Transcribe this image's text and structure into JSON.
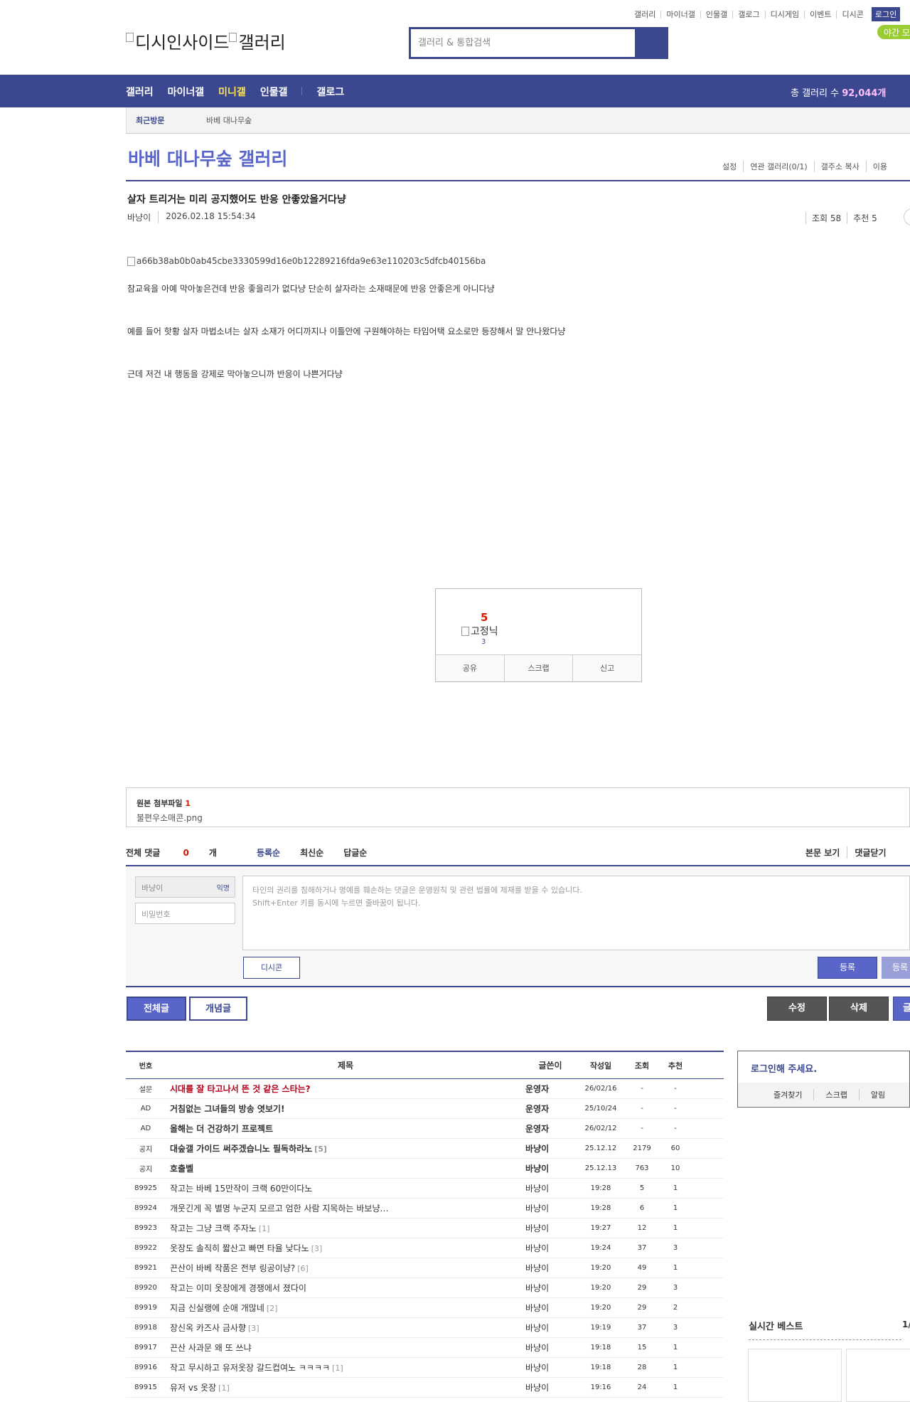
{
  "top_links": [
    "갤러리",
    "마이너갤",
    "인물갤",
    "갤로그",
    "디시게임",
    "이벤트",
    "디시콘"
  ],
  "login_label": "로그인",
  "night_mode_label": "야간 모",
  "logo": {
    "alt1": "디시인사이드",
    "alt2": "갤러리"
  },
  "search": {
    "placeholder": "갤러리 & 통합검색"
  },
  "nav": {
    "items": [
      "갤러리",
      "마이너갤",
      "미니갤",
      "인물갤",
      "갤로그"
    ],
    "active": "미니갤",
    "gallery_count_label": "총 갤러리 수 ",
    "gallery_count_value": "92,044개"
  },
  "recent": {
    "title": "최근방문",
    "gallery": "바베 대나무숲"
  },
  "gallery": {
    "title": "바베 대나무숲 갤러리",
    "links": [
      "설정",
      "연관 갤러리(0/1)",
      "갤주소 복사",
      "이용"
    ]
  },
  "post": {
    "title": "살자 트리거는 미리 공지했어도 반응 안좋았을거다냥",
    "author": "바냥이",
    "date": "2026.02.18 15:54:34",
    "views": "조회 58",
    "recommends": "추천 5",
    "image_alt": "a66b38ab0b0ab45cbe3330599d16e0b12289216fda9e63e110203c5dfcb40156ba",
    "paragraphs": [
      "참교육을 아예 막아놓은건데 반응 좋을리가 없다냥 단순히 살자라는 소재때문에 반응 안좋은게 아니다냥",
      "예를 들어 핫황 살자 마법소녀는 살자 소재가 어디까지나 이틀안에 구원해야하는 타임어택 요소로만 등장해서 말 안나왔다냥",
      "근데 저건 내 행동을 강제로 막아놓으니까 반응이 나쁜거다냥"
    ]
  },
  "recommend_box": {
    "count": "5",
    "fixed_alt": "고정닉",
    "fixed_count": "3",
    "buttons": [
      "공유",
      "스크랩",
      "신고"
    ]
  },
  "attachment": {
    "label": "원본 첨부파일 ",
    "count": "1",
    "file": "불편우소매콘.png"
  },
  "comments": {
    "total_label": "전체 댓글 ",
    "total_count": "0",
    "total_unit": "개",
    "sorts": [
      "등록순",
      "최신순",
      "답글순"
    ],
    "right_links": [
      "본문 보기",
      "댓글닫기"
    ],
    "nick_placeholder": "바냥이",
    "anon_label": "익명",
    "password_placeholder": "비밀번호",
    "textarea_line1": "타인의 권리를 침해하거나 명예를 훼손하는 댓글은 운영원칙 및 관련 법률에 제재를 받을 수 있습니다.",
    "textarea_line2": "Shift+Enter 키를 동시에 누르면 줄바꿈이 됩니다.",
    "dccon_label": "디시콘",
    "submit_label": "등록",
    "submit2_label": "등록"
  },
  "buttons": {
    "all": "전체글",
    "good": "개념글",
    "edit": "수정",
    "delete": "삭제",
    "write": "글"
  },
  "list": {
    "headers": [
      "번호",
      "제목",
      "글쓴이",
      "작성일",
      "조회",
      "추천"
    ],
    "rows": [
      {
        "num": "설문",
        "title": "시대를 잘 타고나서 뜬 것 같은 스타는?",
        "rc": "",
        "writer": "운영자",
        "date": "26/02/16",
        "views": "-",
        "reco": "-",
        "type": "survey"
      },
      {
        "num": "AD",
        "title": "거침없는 그녀들의 방송 엿보기!",
        "rc": "",
        "writer": "운영자",
        "date": "25/10/24",
        "views": "-",
        "reco": "-",
        "type": "bold"
      },
      {
        "num": "AD",
        "title": "올해는 더 건강하기 프로젝트",
        "rc": "",
        "writer": "운영자",
        "date": "26/02/12",
        "views": "-",
        "reco": "-",
        "type": "bold"
      },
      {
        "num": "공지",
        "title": "대숲갤 가이드 써주겠습니노 필독하라노",
        "rc": "[5]",
        "writer": "바냥이",
        "date": "25.12.12",
        "views": "2179",
        "reco": "60",
        "type": "bold"
      },
      {
        "num": "공지",
        "title": "호출벨",
        "rc": "",
        "writer": "바냥이",
        "date": "25.12.13",
        "views": "763",
        "reco": "10",
        "type": "bold"
      },
      {
        "num": "89925",
        "title": "작고는 바베 15만작이 크랙 60만이다노",
        "rc": "",
        "writer": "바냥이",
        "date": "19:28",
        "views": "5",
        "reco": "1",
        "type": ""
      },
      {
        "num": "89924",
        "title": "개웃긴게 꼭 별명 누군지 모르고 엄한 사람 지목하는 바보냥…",
        "rc": "",
        "writer": "바냥이",
        "date": "19:28",
        "views": "6",
        "reco": "1",
        "type": ""
      },
      {
        "num": "89923",
        "title": "작고는 그냥 크랙 주자노",
        "rc": "[1]",
        "writer": "바냥이",
        "date": "19:27",
        "views": "12",
        "reco": "1",
        "type": ""
      },
      {
        "num": "89922",
        "title": "옷장도 솔직히 짧산고 빠면 타율 낮다노",
        "rc": "[3]",
        "writer": "바냥이",
        "date": "19:24",
        "views": "37",
        "reco": "3",
        "type": ""
      },
      {
        "num": "89921",
        "title": "끈산이 바베 작품은 전부 링공이냥?",
        "rc": "[6]",
        "writer": "바냥이",
        "date": "19:20",
        "views": "49",
        "reco": "1",
        "type": ""
      },
      {
        "num": "89920",
        "title": "작고는 이미 옷장에게 경쟁에서 졌다이",
        "rc": "",
        "writer": "바냥이",
        "date": "19:20",
        "views": "29",
        "reco": "3",
        "type": ""
      },
      {
        "num": "89919",
        "title": "지금 신실랭에 순애 개많네",
        "rc": "[2]",
        "writer": "바냥이",
        "date": "19:20",
        "views": "29",
        "reco": "2",
        "type": ""
      },
      {
        "num": "89918",
        "title": "장신옥 카즈사 금사향",
        "rc": "[3]",
        "writer": "바냥이",
        "date": "19:19",
        "views": "37",
        "reco": "3",
        "type": ""
      },
      {
        "num": "89917",
        "title": "끈산 사과문 왜 또 쓰냐",
        "rc": "",
        "writer": "바냥이",
        "date": "19:18",
        "views": "15",
        "reco": "1",
        "type": ""
      },
      {
        "num": "89916",
        "title": "작고 무시하고 유저옷장 갈드컵여노 ㅋㅋㅋㅋ",
        "rc": "[1]",
        "writer": "바냥이",
        "date": "19:18",
        "views": "28",
        "reco": "1",
        "type": ""
      },
      {
        "num": "89915",
        "title": "유저 vs 옷장",
        "rc": "[1]",
        "writer": "바냥이",
        "date": "19:16",
        "views": "24",
        "reco": "1",
        "type": ""
      }
    ]
  },
  "side": {
    "login_title": "로그인해 주세요.",
    "login_links": [
      "즐겨찾기",
      "스크랩",
      "알림"
    ],
    "best_title": "실시간 베스트",
    "best_page": "1/"
  },
  "colors": {
    "brand": "#3b4890",
    "accent": "#5a65c9",
    "hot": "#d31900",
    "night": "#9acd32"
  }
}
